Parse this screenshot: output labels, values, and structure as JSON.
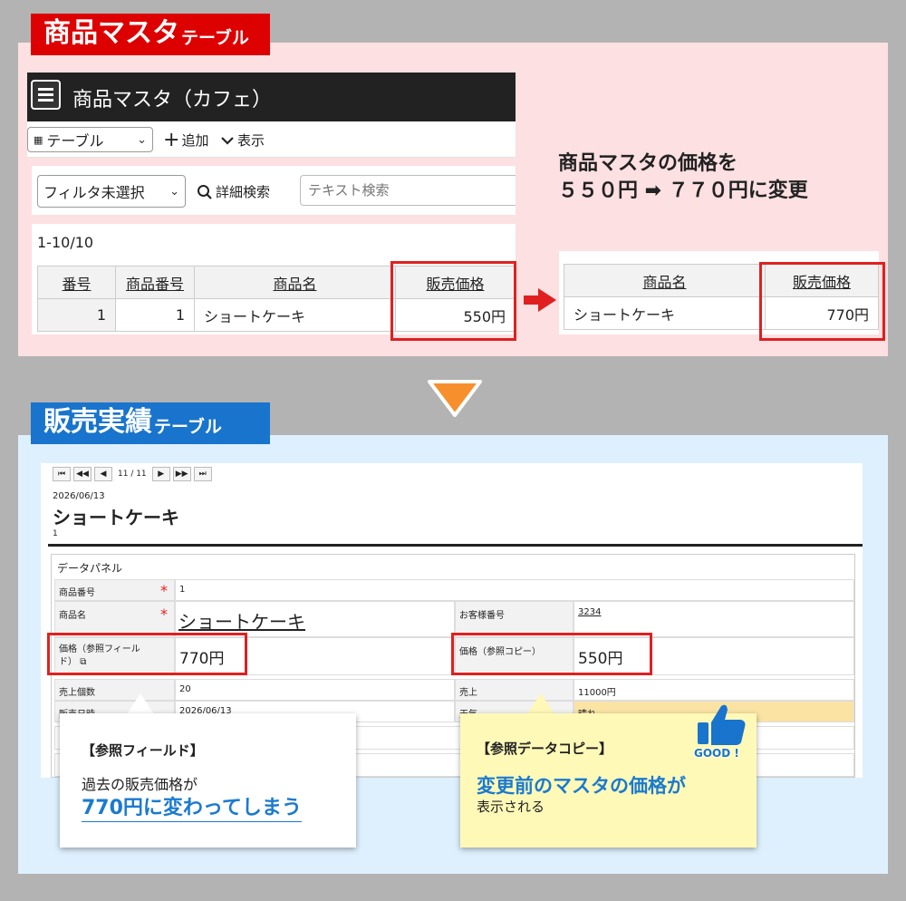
{
  "top_banner": {
    "main": "商品マスタ",
    "sub": "テーブル"
  },
  "bottom_banner": {
    "main": "販売実績",
    "sub": "テーブル"
  },
  "master_app": {
    "title": "商品マスタ（カフェ）",
    "view_select": "テーブル",
    "add_label": "追加",
    "display_label": "表示",
    "filter_select": "フィルタ未選択",
    "advanced_search": "詳細検索",
    "search_placeholder": "テキスト検索",
    "record_count": "1-10/10",
    "columns": [
      "番号",
      "商品番号",
      "商品名",
      "販売価格"
    ],
    "row": [
      "1",
      "1",
      "ショートケーキ",
      "550円"
    ]
  },
  "change_note": {
    "line1": "商品マスタの価格を",
    "line2": "５５０円 ➡ ７７０円に変更"
  },
  "after_table": {
    "columns": [
      "商品名",
      "販売価格"
    ],
    "row": [
      "ショートケーキ",
      "770円"
    ]
  },
  "record": {
    "pager": "11 / 11",
    "date": "2026/06/13",
    "title": "ショートケーキ",
    "id": "1",
    "panel_title": "データパネル",
    "product_no_label": "商品番号",
    "product_no_value": "1",
    "product_name_label": "商品名",
    "product_name_value": "ショートケーキ",
    "customer_no_label": "お客様番号",
    "customer_no_value": "3234",
    "price_ref_label": "価格（参照フィールド）",
    "price_ref_value": "770円",
    "price_copy_label": "価格（参照コピー）",
    "price_copy_value": "550円",
    "qty_label": "売上個数",
    "qty_value": "20",
    "sales_label": "売上",
    "sales_value": "11000円",
    "sale_date_label": "販売日時",
    "sale_date_value": "2026/06/13",
    "weather_label": "天気",
    "weather_value": "晴れ",
    "required_mark": "*"
  },
  "bubble_left": {
    "title": "【参照フィールド】",
    "line1": "過去の販売価格が",
    "line2": "770円に変わってしまう"
  },
  "bubble_right": {
    "title": "【参照データコピー】",
    "line1": "変更前のマスタの価格が",
    "line2": "表示される",
    "badge": "GOOD !"
  },
  "colors": {
    "red": "#dd0000",
    "blue": "#1874cc",
    "accent_text": "#1a7ad0",
    "pink_bg": "#fde0e2",
    "light_blue_bg": "#def0fd",
    "bubble_yellow": "#fff9b8"
  }
}
